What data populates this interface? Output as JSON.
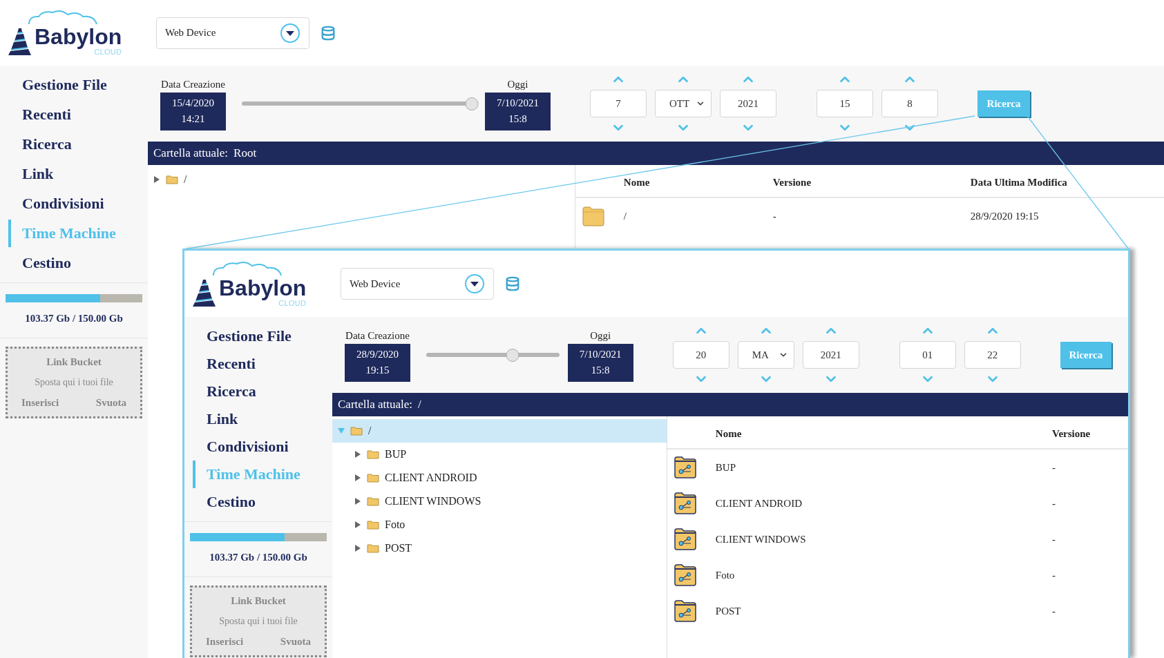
{
  "screen": {
    "logo": {
      "name": "Babylon",
      "tagline": "CLOUD"
    },
    "device_select": {
      "value": "Web Device"
    },
    "nav": [
      {
        "label": "Gestione File",
        "selected": false
      },
      {
        "label": "Recenti",
        "selected": false
      },
      {
        "label": "Ricerca",
        "selected": false
      },
      {
        "label": "Link",
        "selected": false
      },
      {
        "label": "Condivisioni",
        "selected": false
      },
      {
        "label": "Time Machine",
        "selected": true
      },
      {
        "label": "Cestino",
        "selected": false
      }
    ],
    "storage": {
      "level": 0.69,
      "reading": "103.37 Gb / 150.00 Gb"
    },
    "link_bucket": {
      "title": "Link Bucket",
      "hint": "Sposta qui i tuoi file",
      "buttons": [
        "Inserisci",
        "Svuota"
      ]
    },
    "timeline": {
      "start_label": "Data Creazione",
      "start_date": "15/4/2020",
      "start_time": "14:21",
      "end_label": "Oggi",
      "end_date": "7/10/2021",
      "end_time": "15:8",
      "level": 0.98
    },
    "date_fields": [
      {
        "kind": "number",
        "value": "7"
      },
      {
        "kind": "month",
        "value": "OTT"
      },
      {
        "kind": "number",
        "value": "2021"
      }
    ],
    "time_fields": [
      {
        "kind": "number",
        "value": "15"
      },
      {
        "kind": "number",
        "value": "8"
      }
    ],
    "search_button": "Ricerca",
    "current_folder": {
      "label": "Cartella attuale:",
      "value": "Root"
    },
    "tree": [
      {
        "label": "/",
        "expanded": false,
        "selected": false
      }
    ],
    "table": {
      "columns": [
        "Nome",
        "Versione",
        "Data Ultima Modifica"
      ],
      "rows": [
        {
          "kind": "folder",
          "cells": [
            "/",
            "-",
            "28/9/2020 19:15"
          ]
        }
      ]
    }
  },
  "zoom_inset": {
    "logo": {
      "name": "Babylon",
      "tagline": "CLOUD"
    },
    "device_select": {
      "value": "Web Device"
    },
    "nav": [
      {
        "label": "Gestione File",
        "selected": false
      },
      {
        "label": "Recenti",
        "selected": false
      },
      {
        "label": "Ricerca",
        "selected": false
      },
      {
        "label": "Link",
        "selected": false
      },
      {
        "label": "Condivisioni",
        "selected": false
      },
      {
        "label": "Time Machine",
        "selected": true
      },
      {
        "label": "Cestino",
        "selected": false
      }
    ],
    "storage": {
      "level": 0.69,
      "reading": "103.37 Gb / 150.00 Gb"
    },
    "link_bucket": {
      "title": "Link Bucket",
      "hint": "Sposta qui i tuoi file",
      "buttons": [
        "Inserisci",
        "Svuota"
      ]
    },
    "timeline": {
      "start_label": "Data Creazione",
      "start_date": "28/9/2020",
      "start_time": "19:15",
      "end_label": "Oggi",
      "end_date": "7/10/2021",
      "end_time": "15:8",
      "level": 0.65
    },
    "date_fields": [
      {
        "kind": "number",
        "value": "20"
      },
      {
        "kind": "month",
        "value": "MA"
      },
      {
        "kind": "number",
        "value": "2021"
      }
    ],
    "time_fields": [
      {
        "kind": "number",
        "value": "01"
      },
      {
        "kind": "number",
        "value": "22"
      }
    ],
    "search_button": "Ricerca",
    "current_folder": {
      "label": "Cartella attuale:",
      "value": "/"
    },
    "tree": [
      {
        "label": "/",
        "expanded": true,
        "selected": true,
        "children": [
          {
            "label": "BUP",
            "expanded": false,
            "selected": false
          },
          {
            "label": "CLIENT ANDROID",
            "expanded": false,
            "selected": false
          },
          {
            "label": "CLIENT WINDOWS",
            "expanded": false,
            "selected": false
          },
          {
            "label": "Foto",
            "expanded": false,
            "selected": false
          },
          {
            "label": "POST",
            "expanded": false,
            "selected": false
          }
        ]
      }
    ],
    "table": {
      "columns": [
        "Nome",
        "Versione"
      ],
      "rows": [
        {
          "kind": "shared-folder",
          "cells": [
            "BUP",
            "-"
          ]
        },
        {
          "kind": "shared-folder",
          "cells": [
            "CLIENT ANDROID",
            "-"
          ]
        },
        {
          "kind": "shared-folder",
          "cells": [
            "CLIENT WINDOWS",
            "-"
          ]
        },
        {
          "kind": "shared-folder",
          "cells": [
            "Foto",
            "-"
          ]
        },
        {
          "kind": "shared-folder",
          "cells": [
            "POST",
            "-"
          ]
        }
      ]
    }
  }
}
